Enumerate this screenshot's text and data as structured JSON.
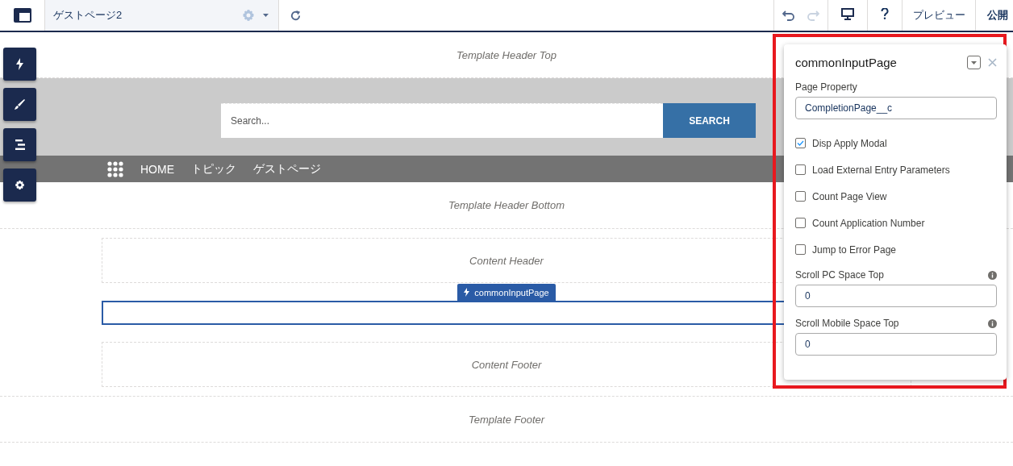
{
  "toolbar": {
    "page_tab": {
      "title": "ゲストページ2"
    },
    "history": [
      {
        "kind": "undo",
        "disabled": false
      },
      {
        "kind": "redo",
        "disabled": true
      }
    ],
    "preview": "プレビュー",
    "publish": "公開"
  },
  "canvas": {
    "header_top": "Template Header Top",
    "search": {
      "placeholder": "Search...",
      "button": "SEARCH"
    },
    "nav": [
      "HOME",
      "トピック",
      "ゲストページ"
    ],
    "header_bottom": "Template Header Bottom",
    "content_header": "Content Header",
    "component_tag": "commonInputPage",
    "content_footer": "Content Footer",
    "footer": "Template Footer"
  },
  "panel": {
    "title": "commonInputPage",
    "fields": [
      {
        "kind": "text",
        "label": "Page Property",
        "value": "CompletionPage__c"
      },
      {
        "kind": "checkbox",
        "label": "Disp Apply Modal",
        "checked": true
      },
      {
        "kind": "checkbox",
        "label": "Load External Entry Parameters",
        "checked": false
      },
      {
        "kind": "checkbox",
        "label": "Count Page View",
        "checked": false
      },
      {
        "kind": "checkbox",
        "label": "Count Application Number",
        "checked": false
      },
      {
        "kind": "checkbox",
        "label": "Jump to Error Page",
        "checked": false
      },
      {
        "kind": "text",
        "label": "Scroll PC Space Top",
        "value": "0",
        "info": true
      },
      {
        "kind": "text",
        "label": "Scroll Mobile Space Top",
        "value": "0",
        "info": true
      }
    ]
  }
}
